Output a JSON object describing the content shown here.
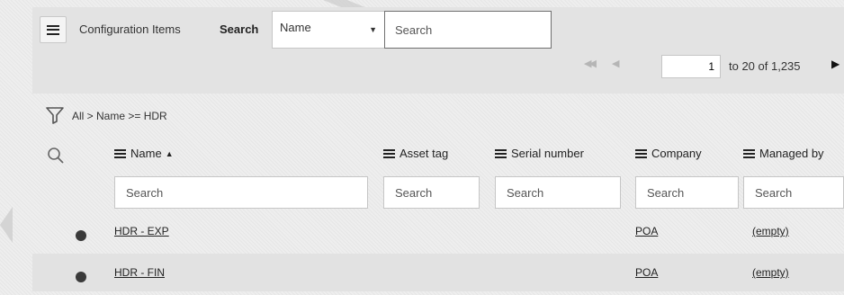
{
  "header": {
    "list_title": "Configuration Items",
    "search_label": "Search",
    "field_select_value": "Name",
    "search_placeholder": "Search"
  },
  "pager": {
    "first_icon": "first-page-icon",
    "prev_icon": "prev-page-icon",
    "next_icon": "next-page-icon",
    "current": "1",
    "range_text": "to 20 of 1,235"
  },
  "filter": {
    "breadcrumb": "All > Name >= HDR"
  },
  "table": {
    "columns": [
      {
        "label": "Name",
        "sort": "▲"
      },
      {
        "label": "Asset tag"
      },
      {
        "label": "Serial number"
      },
      {
        "label": "Company"
      },
      {
        "label": "Managed by"
      }
    ],
    "search_placeholder": "Search",
    "rows": [
      {
        "name": "HDR - EXP",
        "asset_tag": "",
        "serial_number": "",
        "company": "POA",
        "managed_by": "(empty)"
      },
      {
        "name": "HDR - FIN",
        "asset_tag": "",
        "serial_number": "",
        "company": "POA",
        "managed_by": "(empty)"
      }
    ]
  }
}
